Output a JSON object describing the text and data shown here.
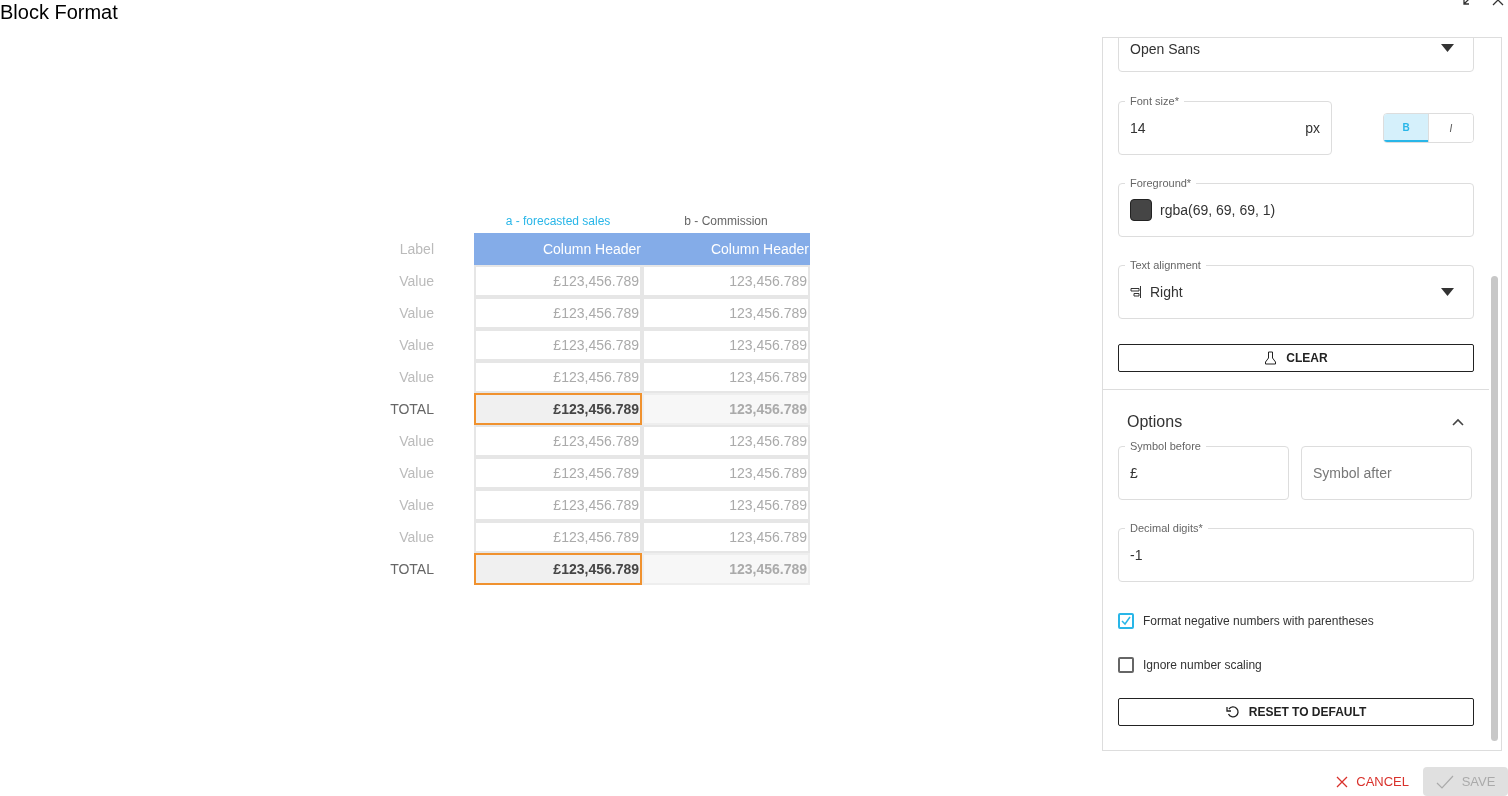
{
  "window": {
    "title": "Block Format"
  },
  "table": {
    "series": [
      {
        "label": "a - forecasted sales",
        "selected": true
      },
      {
        "label": "b - Commission",
        "selected": false
      }
    ],
    "header": {
      "label": "Label",
      "columns": [
        "Column Header",
        "Column Header"
      ]
    },
    "rows": [
      {
        "kind": "value",
        "label": "Value",
        "cells": [
          "£123,456.789",
          "123,456.789"
        ]
      },
      {
        "kind": "value",
        "label": "Value",
        "cells": [
          "£123,456.789",
          "123,456.789"
        ]
      },
      {
        "kind": "value",
        "label": "Value",
        "cells": [
          "£123,456.789",
          "123,456.789"
        ]
      },
      {
        "kind": "value",
        "label": "Value",
        "cells": [
          "£123,456.789",
          "123,456.789"
        ]
      },
      {
        "kind": "total",
        "label": "TOTAL",
        "cells": [
          "£123,456.789",
          "123,456.789"
        ]
      },
      {
        "kind": "value",
        "label": "Value",
        "cells": [
          "£123,456.789",
          "123,456.789"
        ]
      },
      {
        "kind": "value",
        "label": "Value",
        "cells": [
          "£123,456.789",
          "123,456.789"
        ]
      },
      {
        "kind": "value",
        "label": "Value",
        "cells": [
          "£123,456.789",
          "123,456.789"
        ]
      },
      {
        "kind": "value",
        "label": "Value",
        "cells": [
          "£123,456.789",
          "123,456.789"
        ]
      },
      {
        "kind": "total",
        "label": "TOTAL",
        "cells": [
          "£123,456.789",
          "123,456.789"
        ]
      }
    ]
  },
  "panel": {
    "font_family": {
      "value": "Open Sans"
    },
    "font_size": {
      "label": "Font size*",
      "value": "14",
      "unit": "px"
    },
    "style_buttons": [
      {
        "label": "B",
        "selected": true
      },
      {
        "label": "I",
        "selected": false
      }
    ],
    "foreground": {
      "label": "Foreground*",
      "value": "rgba(69, 69, 69, 1)",
      "color": "#454545"
    },
    "text_alignment": {
      "label": "Text alignment",
      "value": "Right"
    },
    "clear_button": "CLEAR",
    "options": {
      "title": "Options",
      "expanded": true,
      "symbol_before": {
        "label": "Symbol before",
        "value": "£"
      },
      "symbol_after": {
        "placeholder": "Symbol after"
      },
      "decimal_digits": {
        "label": "Decimal digits*",
        "value": "-1"
      },
      "checkboxes": [
        {
          "label": "Format negative numbers with parentheses",
          "checked": true
        },
        {
          "label": "Ignore number scaling",
          "checked": false
        }
      ],
      "reset_button": "RESET TO DEFAULT"
    }
  },
  "footer": {
    "cancel": "CANCEL",
    "save": {
      "label": "SAVE",
      "disabled": true
    }
  }
}
